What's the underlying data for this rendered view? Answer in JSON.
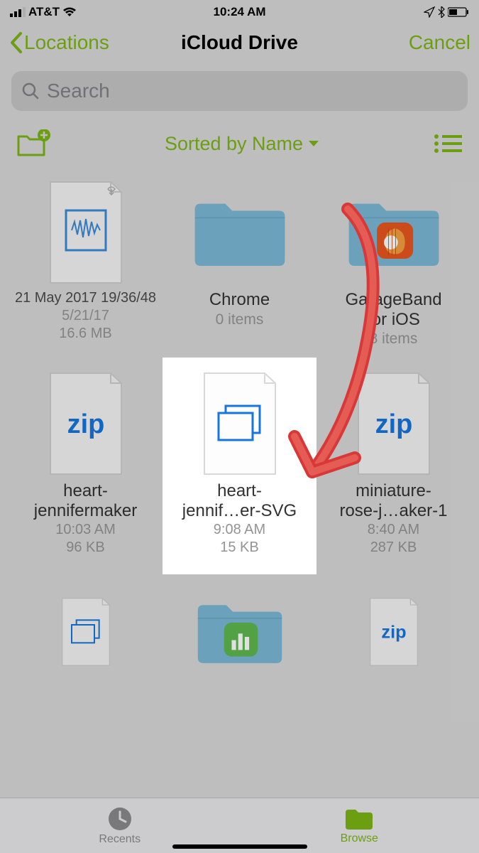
{
  "status": {
    "carrier": "AT&T",
    "time": "10:24 AM"
  },
  "nav": {
    "back": "Locations",
    "title": "iCloud Drive",
    "cancel": "Cancel"
  },
  "search": {
    "placeholder": "Search"
  },
  "toolbar": {
    "sort": "Sorted by Name"
  },
  "items": [
    {
      "name": "21 May 2017\n19/36/48",
      "date": "5/21/17",
      "size": "16.6 MB",
      "type": "file-cloud"
    },
    {
      "name": "Chrome",
      "sub": "0 items",
      "type": "folder"
    },
    {
      "name": "GarageBand\nfor iOS",
      "sub": "8 items",
      "type": "folder-garageband"
    },
    {
      "name": "heart-\njennifermaker",
      "date": "10:03 AM",
      "size": "96 KB",
      "type": "zip"
    },
    {
      "name": "heart-\njennif…er-SVG",
      "date": "9:08 AM",
      "size": "15 KB",
      "type": "svg",
      "selected": true
    },
    {
      "name": "miniature-\nrose-j…aker-1",
      "date": "8:40 AM",
      "size": "287 KB",
      "type": "zip"
    }
  ],
  "tabs": {
    "recents": "Recents",
    "browse": "Browse"
  }
}
